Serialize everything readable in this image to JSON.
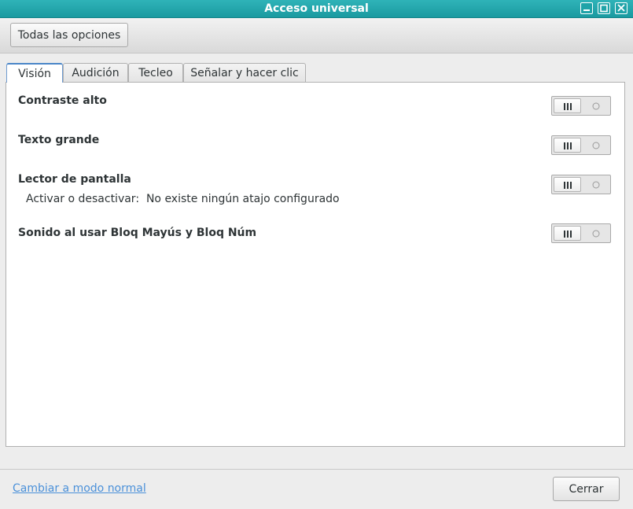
{
  "window": {
    "title": "Acceso universal",
    "controls": [
      "minimize-icon",
      "maximize-icon",
      "close-icon"
    ]
  },
  "toolbar": {
    "all_options_label": "Todas las opciones"
  },
  "tabs": [
    {
      "label": "Visión",
      "active": true
    },
    {
      "label": "Audición",
      "active": false
    },
    {
      "label": "Tecleo",
      "active": false
    },
    {
      "label": "Señalar y hacer clic",
      "active": false
    }
  ],
  "settings": [
    {
      "label": "Contraste alto",
      "enabled": false
    },
    {
      "label": "Texto grande",
      "enabled": false
    },
    {
      "label": "Lector de pantalla",
      "enabled": false,
      "shortcut_label": "Activar o desactivar:",
      "shortcut_value": "No existe ningún atajo configurado"
    },
    {
      "label": "Sonido al usar Bloq Mayús y Bloq Núm",
      "enabled": false
    }
  ],
  "footer": {
    "mode_link": "Cambiar a modo normal",
    "close_label": "Cerrar"
  },
  "colors": {
    "titlebar": "#1fa3a8",
    "link": "#4a90d9",
    "active_tab_border": "#4a86c8"
  }
}
